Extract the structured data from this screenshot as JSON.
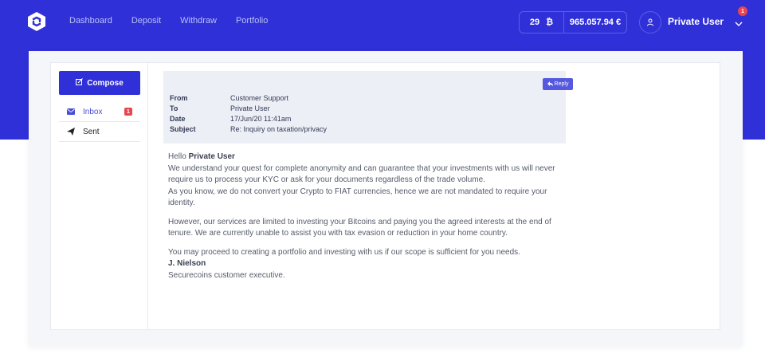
{
  "nav": {
    "items": [
      "Dashboard",
      "Deposit",
      "Withdraw",
      "Portfolio"
    ]
  },
  "wallet": {
    "btc_count": "29",
    "btc_symbol": "₿",
    "eur_amount": "965.057.94 €"
  },
  "user": {
    "name": "Private User",
    "notification_count": "1"
  },
  "colors": {
    "brand": "#3030d8",
    "badge": "#e8454e",
    "reply": "#5559e0"
  },
  "icons": {
    "logo": "hexagon-logo-icon",
    "user": "user-icon",
    "chevron": "chevron-down-icon",
    "compose": "edit-icon",
    "inbox": "envelope-icon",
    "sent": "paper-plane-icon",
    "reply": "reply-icon"
  },
  "sidebar": {
    "compose_label": "Compose",
    "folders": [
      {
        "label": "Inbox",
        "badge": "1"
      },
      {
        "label": "Sent"
      }
    ]
  },
  "message": {
    "reply_label": "Reply",
    "from_label": "From",
    "from": "Customer Support",
    "to_label": "To",
    "to": "Private User",
    "date_label": "Date",
    "date": "17/Jun/20 11:41am",
    "subject_label": "Subject",
    "subject": "Re: Inquiry on taxation/privacy",
    "greeting": "Hello",
    "greeting_name": "Private User",
    "para1a": "We understand your quest for complete anonymity and can guarantee that your investments with us will never require us to process your KYC or ask for your documents regardless of the trade volume.",
    "para1b": "As you know, we do not convert your Crypto to FIAT currencies, hence we are not mandated to require your identity.",
    "para2": "However, our services are limited to investing your Bitcoins and paying you the agreed interests at the end of tenure. We are currently unable to assist you with tax evasion or reduction in your home country.",
    "para3": "You may proceed to creating a portfolio and investing with us if our scope is sufficient for you needs.",
    "signature_name": "J. Nielson",
    "signature_title": "Securecoins customer executive."
  }
}
